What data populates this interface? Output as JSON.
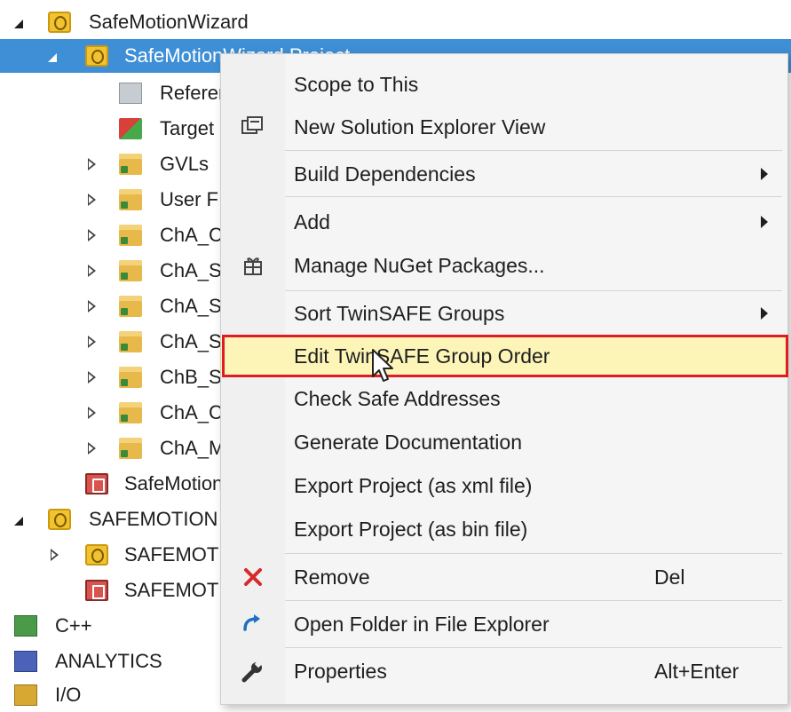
{
  "tree": {
    "items": [
      {
        "label": "SafeMotionWizard"
      },
      {
        "label": "SafeMotionWizard Project"
      },
      {
        "label": "References"
      },
      {
        "label": "Target"
      },
      {
        "label": "GVLs"
      },
      {
        "label": "User F"
      },
      {
        "label": "ChA_C"
      },
      {
        "label": "ChA_S"
      },
      {
        "label": "ChA_S"
      },
      {
        "label": "ChA_S"
      },
      {
        "label": "ChB_S"
      },
      {
        "label": "ChA_C"
      },
      {
        "label": "ChA_M"
      },
      {
        "label": "SafeMotion"
      },
      {
        "label": "SAFEMOTION"
      },
      {
        "label": "SAFEMOT"
      },
      {
        "label": "SAFEMOT"
      },
      {
        "label": "C++"
      },
      {
        "label": "ANALYTICS"
      },
      {
        "label": "I/O"
      }
    ]
  },
  "context_menu": {
    "items": [
      {
        "label": "Scope to This",
        "icon": ""
      },
      {
        "label": "New Solution Explorer View",
        "icon": "new-view-icon"
      },
      {
        "label": "Build Dependencies",
        "submenu": true
      },
      {
        "label": "Add",
        "submenu": true
      },
      {
        "label": "Manage NuGet Packages...",
        "icon": "nuget-package-icon"
      },
      {
        "label": "Sort TwinSAFE Groups",
        "submenu": true
      },
      {
        "label": "Edit TwinSAFE Group Order",
        "highlighted": true
      },
      {
        "label": "Check Safe Addresses"
      },
      {
        "label": "Generate Documentation"
      },
      {
        "label": "Export Project (as xml file)"
      },
      {
        "label": "Export Project (as bin file)"
      },
      {
        "label": "Remove",
        "shortcut": "Del",
        "icon": "remove-x-icon"
      },
      {
        "label": "Open Folder in File Explorer",
        "icon": "open-folder-arrow-icon"
      },
      {
        "label": "Properties",
        "shortcut": "Alt+Enter",
        "icon": "wrench-icon"
      }
    ]
  },
  "colors": {
    "selection": "#3e8fd6",
    "highlight": "#fdf5b8",
    "highlight_border": "#e11b22",
    "remove_icon": "#d42a2a",
    "open_folder_icon": "#1e6fc4"
  }
}
